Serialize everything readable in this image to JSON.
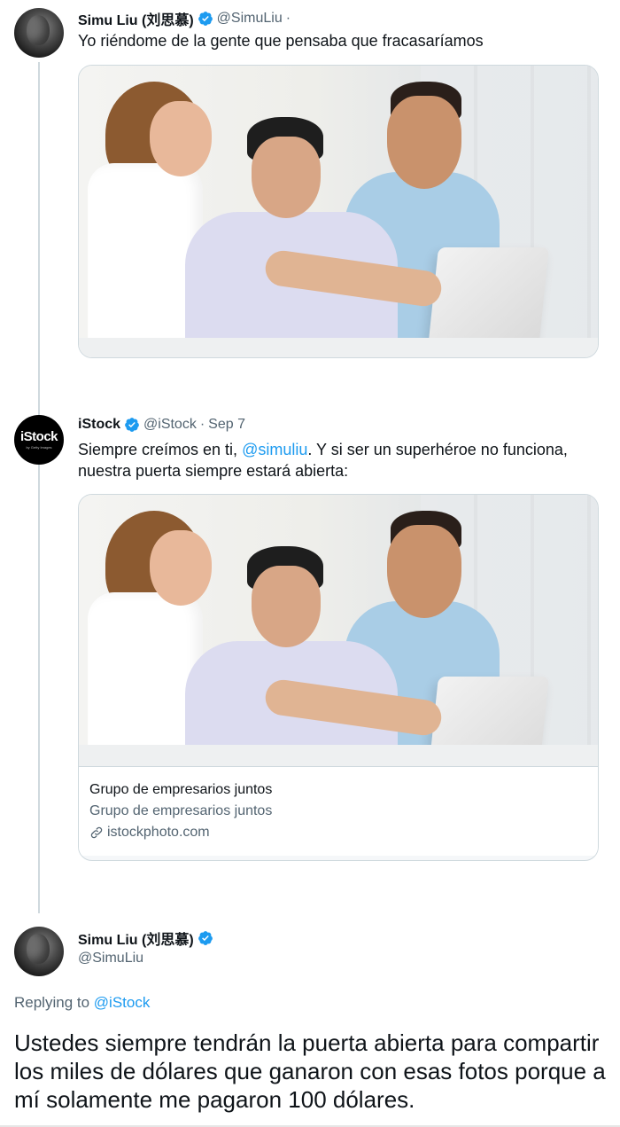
{
  "tweet1": {
    "name": "Simu Liu (刘思慕)",
    "handle": "@SimuLiu",
    "separator": "·",
    "text": "Yo riéndome de la gente que pensaba que fracasaríamos"
  },
  "tweet2": {
    "name": "iStock",
    "avatar_logo": "iStock",
    "avatar_sub": "by Getty Images",
    "handle": "@iStock",
    "separator": "·",
    "date": "Sep 7",
    "text_before": "Siempre creímos en ti, ",
    "mention": "@simuliu",
    "text_after": ". Y si ser un superhéroe no funciona, nuestra puerta siempre estará abierta:",
    "card": {
      "title": "Grupo de empresarios juntos",
      "description": "Grupo de empresarios juntos",
      "domain": "istockphoto.com"
    }
  },
  "tweet3": {
    "name": "Simu Liu (刘思慕)",
    "handle": "@SimuLiu",
    "replying_prefix": "Replying to ",
    "replying_handle": "@iStock",
    "text": "Ustedes siempre tendrán la puerta abierta para compartir los miles de dólares que ganaron con esas fotos porque a mí solamente me pagaron 100 dólares."
  },
  "colors": {
    "accent": "#1d9bf0",
    "text": "#0f1419",
    "secondary": "#536471",
    "border": "#cfd9de"
  },
  "icons": [
    "verified-badge-icon",
    "link-icon"
  ]
}
